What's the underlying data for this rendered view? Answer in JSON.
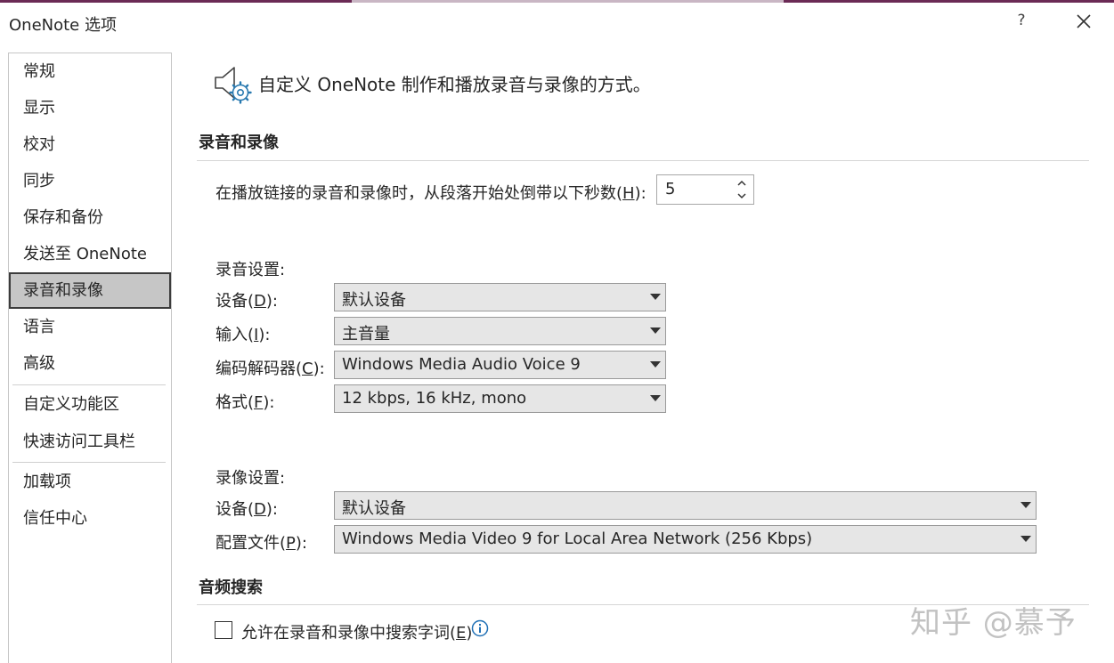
{
  "window": {
    "title": "OneNote 选项",
    "help_label": "?",
    "accent_color": "#6b2a55"
  },
  "sidebar": {
    "items": [
      {
        "label": "常规"
      },
      {
        "label": "显示"
      },
      {
        "label": "校对"
      },
      {
        "label": "同步"
      },
      {
        "label": "保存和备份"
      },
      {
        "label": "发送至 OneNote"
      },
      {
        "label": "录音和录像",
        "selected": true
      },
      {
        "label": "语言"
      },
      {
        "label": "高级"
      },
      {
        "label": "自定义功能区"
      },
      {
        "label": "快速访问工具栏"
      },
      {
        "label": "加载项"
      },
      {
        "label": "信任中心"
      }
    ]
  },
  "intro": {
    "icon": "speaker-gear-icon",
    "text": "自定义 OneNote 制作和播放录音与录像的方式。"
  },
  "recording_section": {
    "title": "录音和录像",
    "rewind_label_pre": "在播放链接的录音和录像时，从段落开始处倒带以下秒数(",
    "rewind_label_key": "H",
    "rewind_label_post": "):",
    "rewind_value": "5"
  },
  "audio": {
    "heading": "录音设置:",
    "device": {
      "label_pre": "设备(",
      "key": "D",
      "label_post": "):",
      "value": "默认设备"
    },
    "input": {
      "label_pre": "输入(",
      "key": "I",
      "label_post": "):",
      "value": "主音量"
    },
    "codec": {
      "label_pre": "编码解码器(",
      "key": "C",
      "label_post": "):",
      "value": "Windows Media Audio Voice 9"
    },
    "format": {
      "label_pre": "格式(",
      "key": "F",
      "label_post": "):",
      "value": "12 kbps, 16 kHz, mono"
    }
  },
  "video": {
    "heading": "录像设置:",
    "device": {
      "label_pre": "设备(",
      "key": "D",
      "label_post": "):",
      "value": "默认设备"
    },
    "profile": {
      "label_pre": "配置文件(",
      "key": "P",
      "label_post": "):",
      "value": "Windows Media Video 9 for Local Area Network (256 Kbps)"
    }
  },
  "audio_search": {
    "title": "音频搜索",
    "checkbox_pre": "允许在录音和录像中搜索字词(",
    "checkbox_key": "E",
    "checkbox_post": ")",
    "checked": false
  },
  "watermark": "知乎 @慕予"
}
